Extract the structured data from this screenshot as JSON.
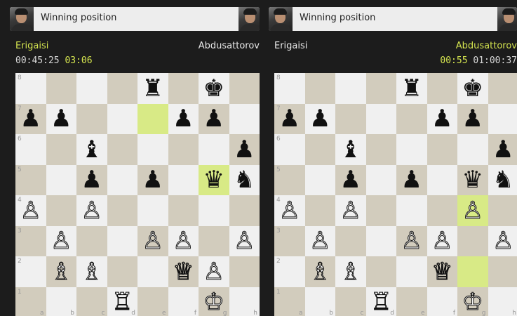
{
  "left": {
    "banner": "Winning position",
    "white_name": "Erigaisi",
    "black_name": "Abdusattorov",
    "clock_1": "00:45:25",
    "clock_2": "03:06",
    "highlights": [
      "e7",
      "g5"
    ],
    "pieces": {
      "e8": "bR",
      "g8": "bK",
      "a7": "bP",
      "b7": "bP",
      "f7": "bP",
      "g7": "bP",
      "c6": "bB",
      "h6": "bP",
      "c5": "bP",
      "e5": "bP",
      "g5": "bQ",
      "h5": "bN",
      "a4": "wP",
      "c4": "wP",
      "b3": "wP",
      "e3": "wP",
      "f3": "wP",
      "h3": "wP",
      "b2": "wB",
      "c2": "wB",
      "f2": "wQ",
      "g2": "wP",
      "d1": "wR",
      "g1": "wK"
    }
  },
  "right": {
    "banner": "Winning position",
    "white_name": "Erigaisi",
    "black_name": "Abdusattorov",
    "clock_1": "00:55",
    "clock_2": "01:00:37",
    "highlights": [
      "g4",
      "g2"
    ],
    "pieces": {
      "e8": "bR",
      "g8": "bK",
      "a7": "bP",
      "b7": "bP",
      "f7": "bP",
      "g7": "bP",
      "c6": "bB",
      "h6": "bP",
      "c5": "bP",
      "e5": "bP",
      "g5": "bQ",
      "h5": "bN",
      "a4": "wP",
      "c4": "wP",
      "g4": "wP",
      "b3": "wP",
      "e3": "wP",
      "f3": "wP",
      "h3": "wP",
      "b2": "wB",
      "c2": "wB",
      "f2": "wQ",
      "d1": "wR",
      "g1": "wK"
    }
  },
  "glyphs": {
    "wK": "♔",
    "wQ": "♕",
    "wR": "♖",
    "wB": "♗",
    "wN": "♘",
    "wP": "♙",
    "bK": "♚",
    "bQ": "♛",
    "bR": "♜",
    "bB": "♝",
    "bN": "♞",
    "bP": "♟"
  },
  "files": [
    "a",
    "b",
    "c",
    "d",
    "e",
    "f",
    "g",
    "h"
  ],
  "ranks": [
    "8",
    "7",
    "6",
    "5",
    "4",
    "3",
    "2",
    "1"
  ]
}
